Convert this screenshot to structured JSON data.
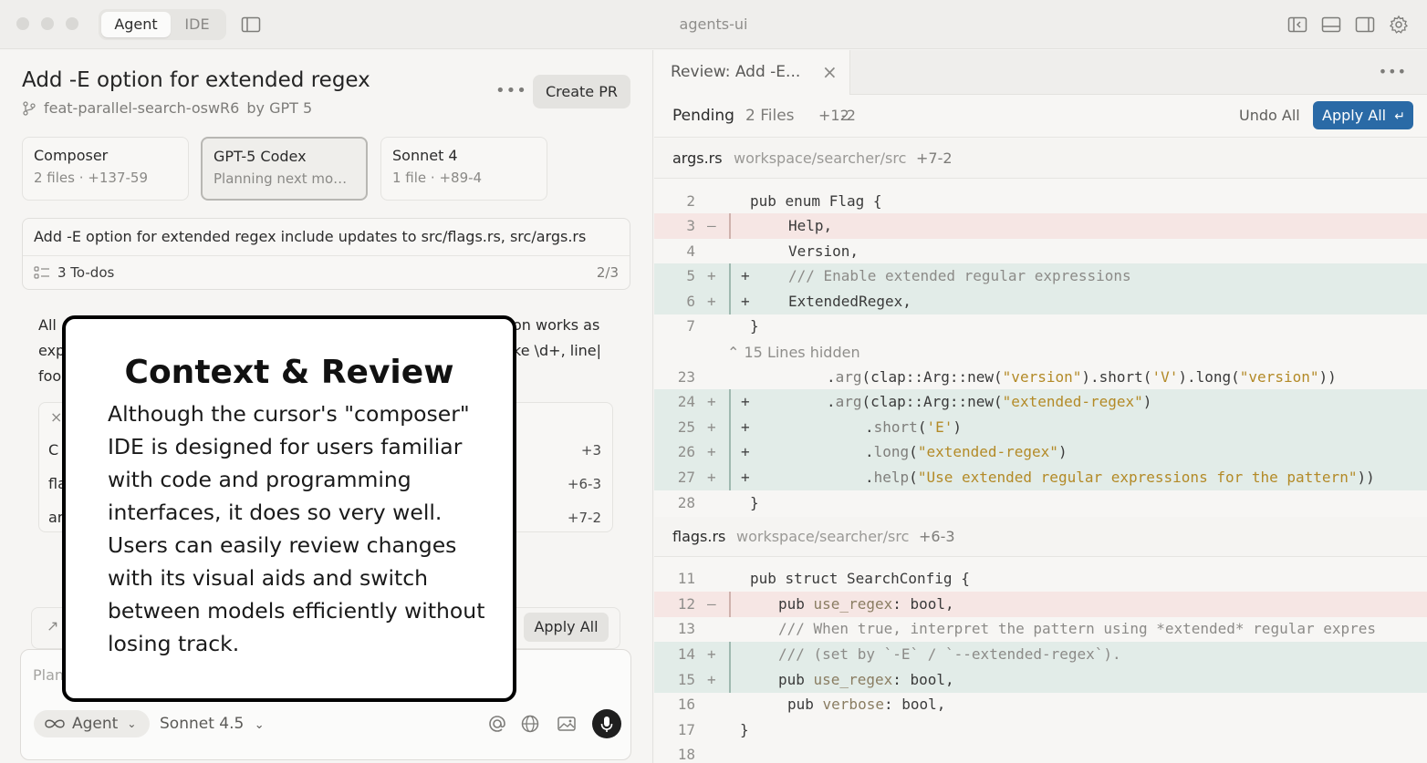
{
  "titlebar": {
    "mode_tabs": [
      "Agent",
      "IDE"
    ],
    "window_title": "agents-ui"
  },
  "task": {
    "title": "Add -E option for extended regex",
    "branch": "feat-parallel-search-oswR6",
    "by_label": "by GPT 5",
    "create_pr_label": "Create PR"
  },
  "models": [
    {
      "name": "Composer",
      "files": "2 files",
      "stat": "+137-59"
    },
    {
      "name": "GPT-5 Codex",
      "status": "Planning next moves"
    },
    {
      "name": "Sonnet 4",
      "files": "1 file",
      "stat": "+89-4"
    }
  ],
  "todo": {
    "description": "Add -E option for extended regex include updates to src/flags.rs, src/args.rs",
    "count_label": "3 To-dos",
    "fraction": "2/3"
  },
  "background": {
    "line1_a": "All",
    "line1_b": "on works as",
    "line2_a": "exp",
    "line2_b": "ke \\d+, line|",
    "line3_a": "foo",
    "changes": [
      {
        "name_fragment": "C",
        "stat": "+3"
      },
      {
        "name_fragment": "fla",
        "stat": "+6-3"
      },
      {
        "name_fragment": "ar",
        "stat": "+7-2"
      }
    ],
    "apply_all_label": "Apply All"
  },
  "composer": {
    "placeholder": "Plan",
    "agent_label": "Agent",
    "model_label": "Sonnet 4.5"
  },
  "overlay": {
    "title": "Context & Review",
    "body": "Although the cursor's \"composer\" IDE is designed for users familiar with code and programming interfaces, it does so very well. Users can easily review changes with its visual aids and switch between models efficiently without losing track."
  },
  "review": {
    "tab_label": "Review: Add -E...",
    "pending_label": "Pending",
    "files_label": "2 Files",
    "additions": "+12",
    "deletions": "-2",
    "undo_all_label": "Undo All",
    "apply_all_label": "Apply All",
    "files": [
      {
        "name": "args.rs",
        "path": "workspace/searcher/src",
        "stat": "+7-2"
      },
      {
        "name": "flags.rs",
        "path": "workspace/searcher/src",
        "stat": "+6-3"
      }
    ],
    "hidden_label": "15 Lines hidden"
  },
  "colors": {
    "accent": "#2a6aa6",
    "added_bg": "#e2ece8",
    "removed_bg": "#f6e6e4"
  }
}
